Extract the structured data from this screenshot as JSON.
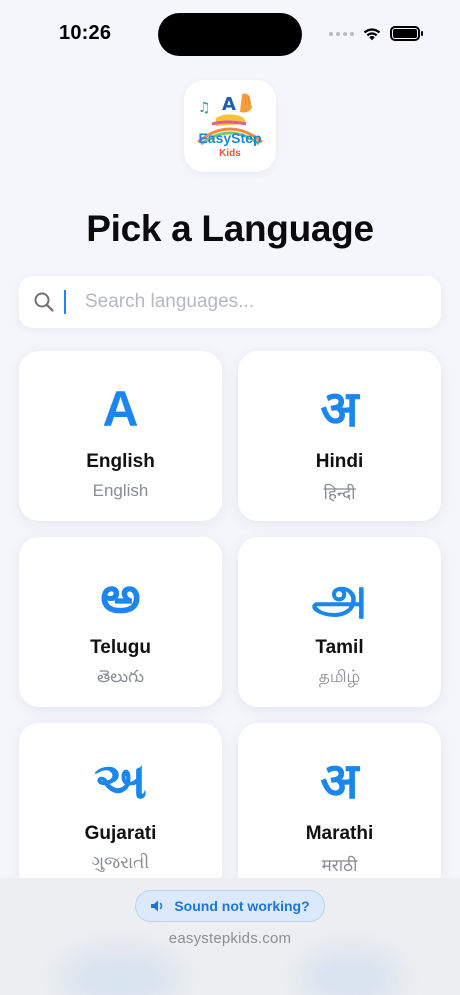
{
  "status_bar": {
    "time": "10:26"
  },
  "logo": {
    "brand_line1": "EasyStep",
    "brand_line2": "Kids",
    "letter": "A"
  },
  "page": {
    "title": "Pick a Language"
  },
  "search": {
    "placeholder": "Search languages...",
    "value": ""
  },
  "languages": [
    {
      "glyph": "A",
      "name": "English",
      "native": "English"
    },
    {
      "glyph": "अ",
      "name": "Hindi",
      "native": "हिन्दी"
    },
    {
      "glyph": "అ",
      "name": "Telugu",
      "native": "తెలుగు"
    },
    {
      "glyph": "அ",
      "name": "Tamil",
      "native": "தமிழ்"
    },
    {
      "glyph": "અ",
      "name": "Gujarati",
      "native": "ગુજરાતી"
    },
    {
      "glyph": "अ",
      "name": "Marathi",
      "native": "मराठी"
    }
  ],
  "footer": {
    "sound_button": "Sound not working?",
    "site": "easystepkids.com"
  },
  "colors": {
    "accent": "#1a86ee",
    "background": "#f5f6fb",
    "card": "#ffffff"
  },
  "icons": {
    "search": "magnifier-icon",
    "sound": "speaker-icon",
    "wifi": "wifi-icon",
    "battery": "battery-icon"
  }
}
